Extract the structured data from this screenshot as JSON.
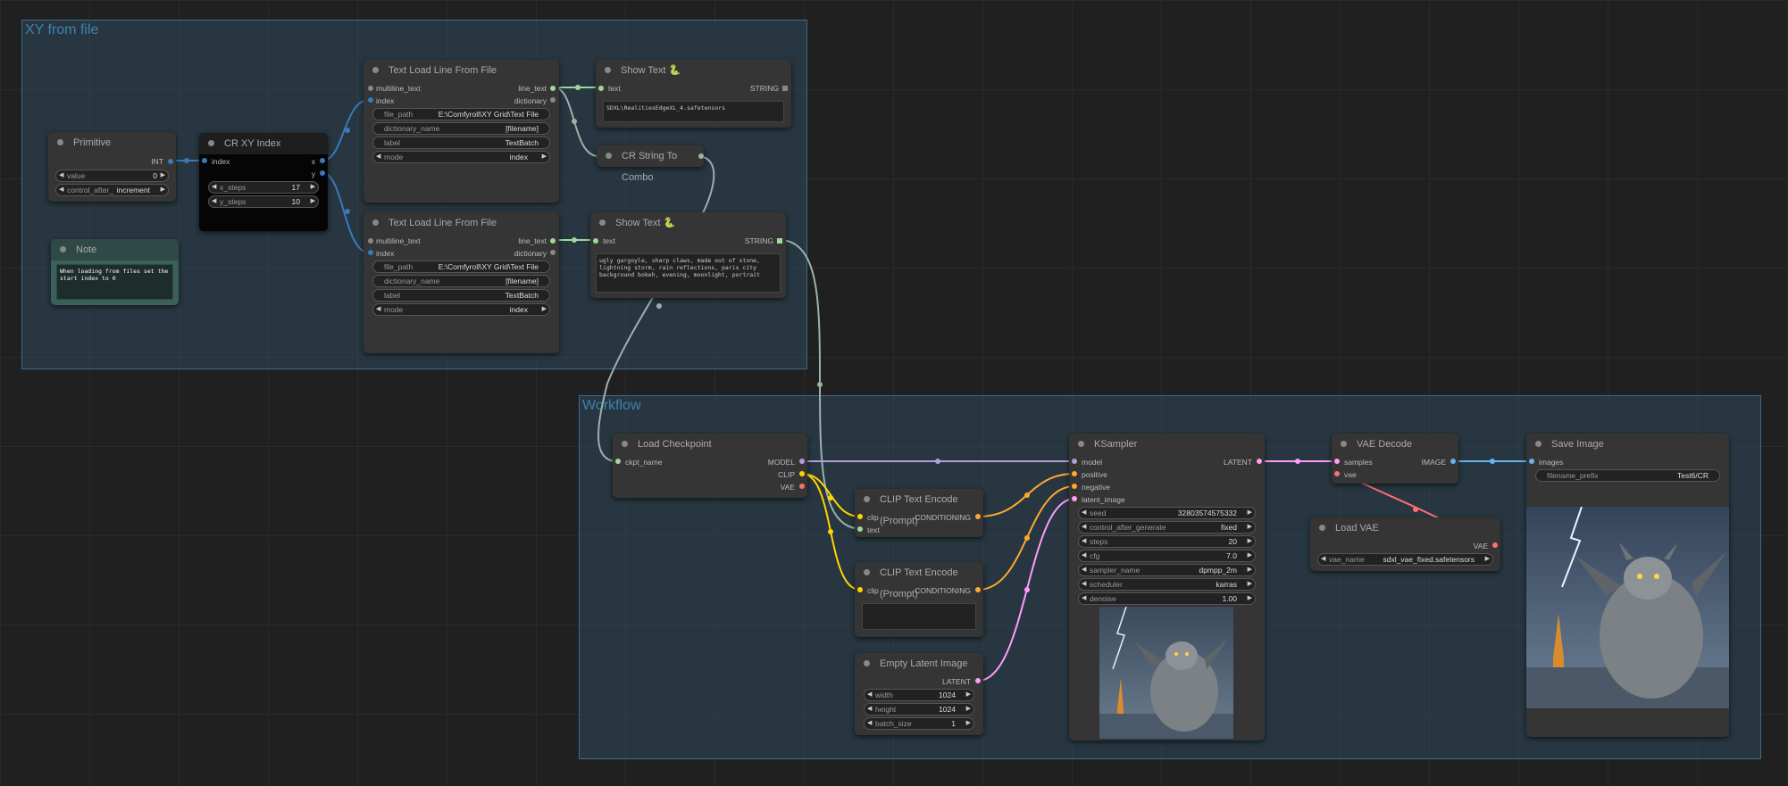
{
  "groups": {
    "xy": "XY from file",
    "workflow": "Workflow"
  },
  "primitive": {
    "title": "Primitive",
    "out": "INT",
    "value_label": "value",
    "value": "0",
    "control_label": "control_after_",
    "control_value": "increment"
  },
  "cr_xy_index": {
    "title": "CR XY Index",
    "in_index": "index",
    "out_x": "x",
    "out_y": "y",
    "x_steps_label": "x_steps",
    "x_steps": "17",
    "y_steps_label": "y_steps",
    "y_steps": "10"
  },
  "note": {
    "title": "Note",
    "text": "When loading from files set the\nstart index to 0"
  },
  "text_load_1": {
    "title": "Text Load Line From File",
    "in_multiline": "multiline_text",
    "in_index": "index",
    "out_line": "line_text",
    "out_dict": "dictionary",
    "file_path_label": "file_path",
    "file_path": "E:\\Comfyroll\\XY Grid\\Text File",
    "dict_label": "dictionary_name",
    "dict_value": "[filename]",
    "label_label": "label",
    "label_value": "TextBatch",
    "mode_label": "mode",
    "mode_value": "index"
  },
  "text_load_2": {
    "title": "Text Load Line From File",
    "in_multiline": "multiline_text",
    "in_index": "index",
    "out_line": "line_text",
    "out_dict": "dictionary",
    "file_path_label": "file_path",
    "file_path": "E:\\Comfyroll\\XY Grid\\Text File",
    "dict_label": "dictionary_name",
    "dict_value": "[filename]",
    "label_label": "label",
    "label_value": "TextBatch",
    "mode_label": "mode",
    "mode_value": "index"
  },
  "show_text_1": {
    "title": "Show Text 🐍",
    "in_text": "text",
    "out": "STRING",
    "content": "SDXL\\RealitiesEdgeXL_4.safetensors"
  },
  "cr_string_combo": {
    "title": "CR String To Combo"
  },
  "show_text_2": {
    "title": "Show Text 🐍",
    "in_text": "text",
    "out": "STRING",
    "content": "ugly gargoyle, sharp claws, made out of stone, lightning storm, rain reflections, paris city background bokeh, evening, moonlight, portrait"
  },
  "load_checkpoint": {
    "title": "Load Checkpoint",
    "in_ckpt": "ckpt_name",
    "out_model": "MODEL",
    "out_clip": "CLIP",
    "out_vae": "VAE"
  },
  "clip_1": {
    "title": "CLIP Text Encode (Prompt)",
    "in_clip": "clip",
    "in_text": "text",
    "out": "CONDITIONING"
  },
  "clip_2": {
    "title": "CLIP Text Encode (Prompt)",
    "in_clip": "clip",
    "out": "CONDITIONING"
  },
  "empty_latent": {
    "title": "Empty Latent Image",
    "out": "LATENT",
    "width_label": "width",
    "width": "1024",
    "height_label": "height",
    "height": "1024",
    "batch_label": "batch_size",
    "batch": "1"
  },
  "ksampler": {
    "title": "KSampler",
    "in_model": "model",
    "in_positive": "positive",
    "in_negative": "negative",
    "in_latent": "latent_image",
    "out": "LATENT",
    "seed_label": "seed",
    "seed": "32803574575332",
    "cag_label": "control_after_generate",
    "cag": "fixed",
    "steps_label": "steps",
    "steps": "20",
    "cfg_label": "cfg",
    "cfg": "7.0",
    "sampler_label": "sampler_name",
    "sampler": "dpmpp_2m",
    "scheduler_label": "scheduler",
    "scheduler": "karras",
    "denoise_label": "denoise",
    "denoise": "1.00"
  },
  "vae_decode": {
    "title": "VAE Decode",
    "in_samples": "samples",
    "in_vae": "vae",
    "out": "IMAGE"
  },
  "load_vae": {
    "title": "Load VAE",
    "out": "VAE",
    "vae_label": "vae_name",
    "vae_value": "sdxl_vae_fixed.safetensors"
  },
  "save_image": {
    "title": "Save Image",
    "in_images": "images",
    "prefix_label": "filename_prefix",
    "prefix_value": "Test6/CR"
  },
  "colors": {
    "model": "#b39ddb",
    "clip": "#ffd500",
    "vae": "#ff6e6e",
    "conditioning": "#ffa931",
    "latent": "#ff9cf9",
    "image": "#64b5f6",
    "int": "#3a7ab5",
    "string": "#9fd89a",
    "text_link": "#9bb2a8"
  }
}
